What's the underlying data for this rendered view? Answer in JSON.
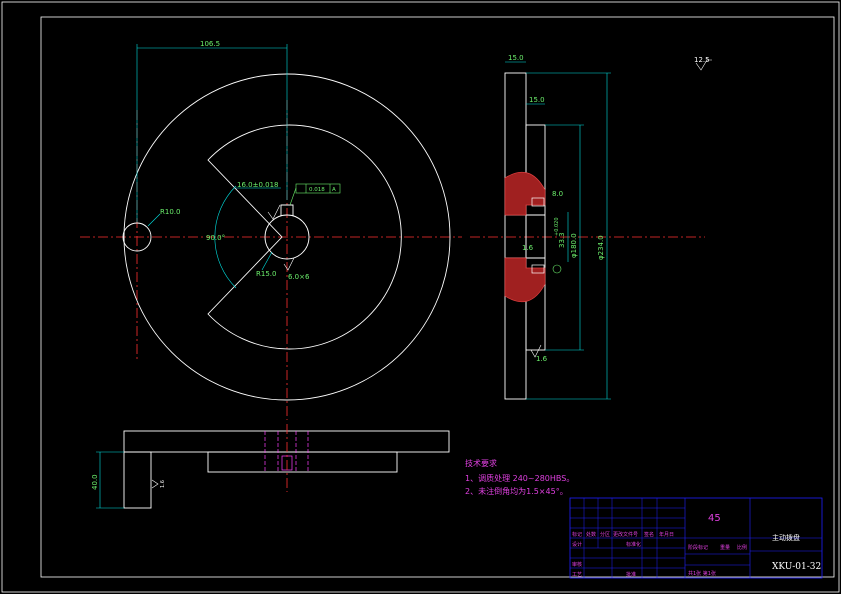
{
  "colors": {
    "background": "#000000",
    "outline": "#ffffff",
    "center_line": "#ff3030",
    "dimension": "#00e0e0",
    "dimension_text": "#6cf06c",
    "hidden_line": "#ff40ff",
    "hatch": "#e04040",
    "title_block": "#2020ff",
    "note_text": "#e040e0",
    "material_text": "#e040e0"
  },
  "front_view": {
    "dim_width": "106.5",
    "dim_key_width": "16.0±0.018",
    "dim_small_radius": "R10.0",
    "dim_angle": "90.0°",
    "dim_bore_radius": "R15.0",
    "dim_hole": "6.0×6",
    "tolerance_frame": "0.018",
    "datum": "A"
  },
  "side_view": {
    "dim_thickness": "15.0",
    "dim_step": "15.0",
    "dim_slot": "8.0",
    "dim_outer_diameter": "φ234.0",
    "dim_mid_diameter": "φ180.0",
    "dim_bore_diameter": "33.3",
    "dim_bore_tol": "+0.020",
    "dim_chamfer_top": "1.6",
    "dim_chamfer_bottom": "1.6",
    "surface_finish": "12.5"
  },
  "bottom_view": {
    "dim_height": "40.0",
    "surface_mark": "1.6"
  },
  "notes": {
    "heading": "技术要求",
    "items": [
      "1、调质处理 240~280HBS。",
      "2、未注倒角均为1.5×45°。"
    ]
  },
  "title_block": {
    "material": "45",
    "part_name": "主动拨盘",
    "drawing_number": "XKU-01-32",
    "row_labels": [
      "标记",
      "处数",
      "分区",
      "更改文件号",
      "签名",
      "年月日"
    ],
    "left_labels": [
      "设计",
      "审核",
      "工艺"
    ],
    "standardize_label": "标准化",
    "approve_label": "批准",
    "stage_label": "阶段标记",
    "weight_label": "重量",
    "scale_label": "比例",
    "sheet_info": "共1张 第1张"
  }
}
